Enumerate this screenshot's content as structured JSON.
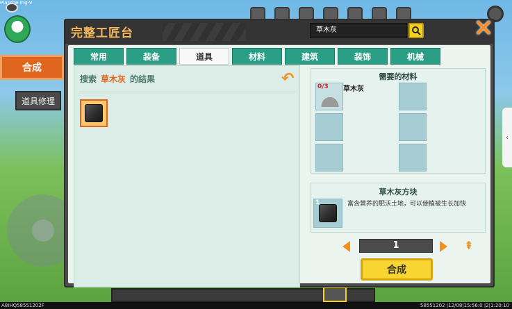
{
  "overlay": {
    "corner_text": "Plasshe Ing-V"
  },
  "side_tabs": {
    "synth": "合成",
    "repair": "道具修理"
  },
  "panel": {
    "title": "完整工匠台",
    "search_value": "草木灰",
    "search_icon": "search-icon",
    "close_icon": "close-x-icon"
  },
  "tabs": [
    "常用",
    "装备",
    "道具",
    "材料",
    "建筑",
    "装饰",
    "机械"
  ],
  "active_tab_index": 2,
  "search_result": {
    "prefix": "搜索",
    "keyword": "草木灰",
    "suffix": "的结果"
  },
  "materials": {
    "title": "需要的材料",
    "items": [
      {
        "name": "草木灰",
        "count": "0/3"
      }
    ]
  },
  "result": {
    "title": "草木灰方块",
    "count": "1",
    "description": "富含营养的肥沃土地，可以使植被生长加快"
  },
  "quantity": "1",
  "craft_label": "合成",
  "status_bar": {
    "left": "A8IHQ58551202F",
    "right": "58551202 |12/08|15:56:0 |2|1:20:10"
  },
  "colors": {
    "accent": "#e0661f",
    "tab": "#2b9e86",
    "craft": "#f8d530"
  }
}
